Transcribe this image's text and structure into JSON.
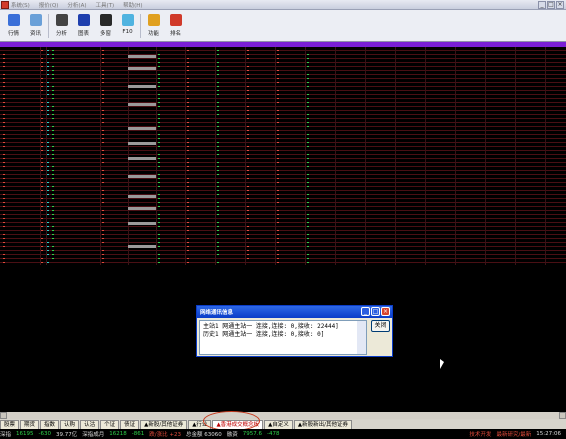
{
  "menu": [
    "系统(S)",
    "报价(Q)",
    "分析(A)",
    "工具(T)",
    "帮助(H)"
  ],
  "toolbar": [
    {
      "label": "行情",
      "icon": "quotes-icon",
      "color": "#3a6fd8"
    },
    {
      "label": "资讯",
      "icon": "info-icon",
      "color": "#6aa0d8"
    },
    {
      "label": "分析",
      "icon": "analysis-icon",
      "color": "#444"
    },
    {
      "label": "图表",
      "icon": "chart-icon",
      "color": "#1f3fae"
    },
    {
      "label": "多窗",
      "icon": "multi-window-icon",
      "color": "#2a2a2a"
    },
    {
      "label": "F10",
      "icon": "f10-icon",
      "color": "#4fb3e0"
    },
    {
      "label": "功能",
      "icon": "function-icon",
      "color": "#e0a020"
    },
    {
      "label": "排名",
      "icon": "ranking-icon",
      "color": "#d03a2a"
    }
  ],
  "dialog": {
    "title": "网络通讯信息",
    "line1": "主站1 网通主站一 连接,连接: 0,接收: 22444]",
    "line2": "历史1 网通主站一 连接,连接: 0,接收: 0]",
    "close_label": "关闭"
  },
  "tabs": [
    "股票",
    "期货",
    "指数",
    "认购",
    "认沽",
    "个证",
    "债证",
    "▲新股/其他证券",
    "▲行业",
    "▲香港成交概念板",
    "▲自定义",
    "▲新股新出/其他证券"
  ],
  "active_tab": 9,
  "status": {
    "index1_name": "深指",
    "index1_value": "16195",
    "index1_change": "-630",
    "index1_volume": "39.77亿",
    "index2_name": "深指成月",
    "index2_value": "16218",
    "index2_change": "-861",
    "up_down": "跌/涨比 +23",
    "total": "总金额 63060",
    "label3": "融资",
    "value3": "7957.6",
    "change3": "-478",
    "right1": "技术开发",
    "right2": "最新研究/最新",
    "time": "15:27:06"
  }
}
